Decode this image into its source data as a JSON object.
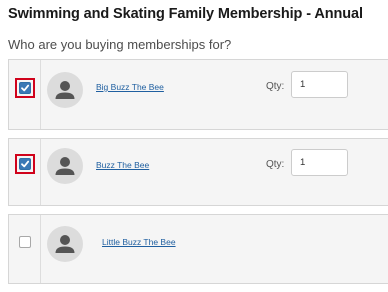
{
  "header": {
    "title": "Swimming and Skating Family Membership - Annual",
    "subtitle": "Who are you buying memberships for?"
  },
  "members": [
    {
      "name": "Big Buzz The Bee",
      "checked": true,
      "highlighted": true,
      "qty_label": "Qty:",
      "qty_value": "1"
    },
    {
      "name": "Buzz The Bee",
      "checked": true,
      "highlighted": true,
      "qty_label": "Qty:",
      "qty_value": "1"
    },
    {
      "name": "Little Buzz The Bee",
      "checked": false,
      "highlighted": false
    }
  ],
  "colors": {
    "checkbox_checked": "#3a78b5",
    "highlight_border": "#d0021b",
    "link": "#1f5fa0",
    "card_background": "#f5f5f5"
  },
  "icons": {
    "avatar": "user-silhouette-icon",
    "check": "checkmark-icon"
  }
}
